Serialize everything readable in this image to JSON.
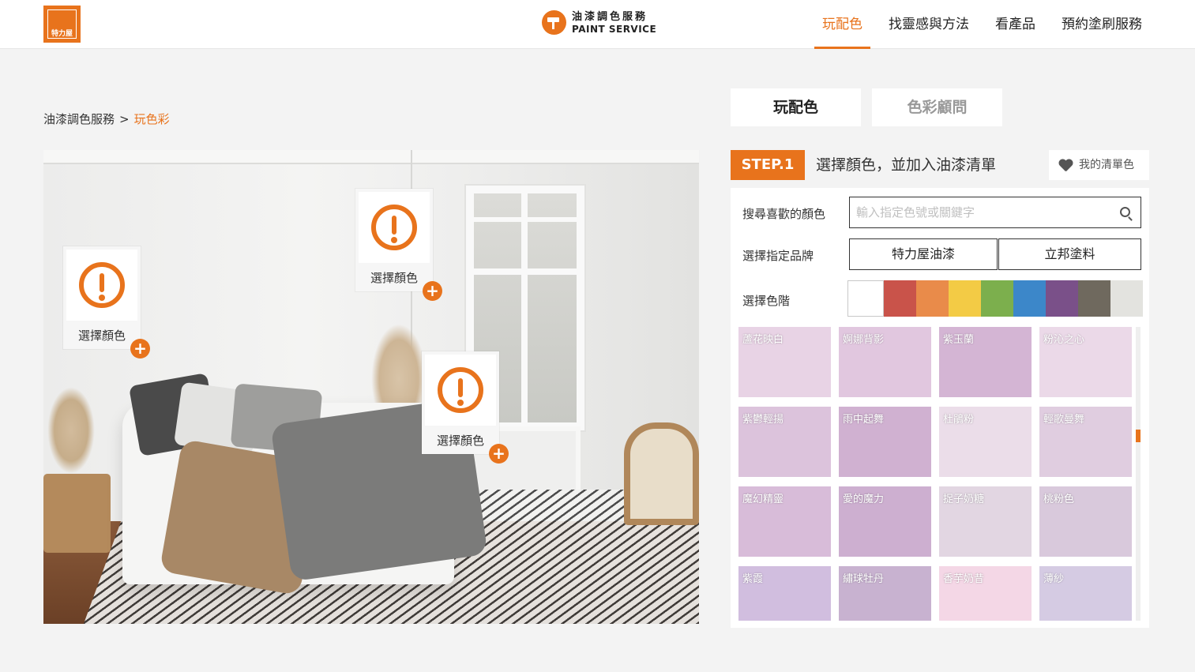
{
  "header": {
    "logo_text": "特力屋",
    "brand_zh": "油漆調色服務",
    "brand_en": "PAINT SERVICE",
    "nav": [
      "玩配色",
      "找靈感與方法",
      "看產品",
      "預約塗刷服務"
    ],
    "accent_color": "#e8731c"
  },
  "breadcrumb": {
    "root": "油漆調色服務",
    "separator": ">",
    "current": "玩色彩"
  },
  "room": {
    "hotspots": [
      {
        "label": "選擇顏色",
        "icon": "alert-icon"
      },
      {
        "label": "選擇顏色",
        "icon": "alert-icon"
      },
      {
        "label": "選擇顏色",
        "icon": "alert-icon"
      }
    ],
    "plus_symbol": "+"
  },
  "panel": {
    "tabs": [
      "玩配色",
      "色彩顧問"
    ],
    "step_badge": "STEP.1",
    "step_title": "選擇顏色，並加入油漆清單",
    "my_list_label": "我的清單色",
    "search_label": "搜尋喜歡的顏色",
    "search_placeholder": "輸入指定色號或關鍵字",
    "brand_label": "選擇指定品牌",
    "brands": [
      "特力屋油漆",
      "立邦塗料"
    ],
    "shade_label": "選擇色階",
    "shades": [
      "#ffffff",
      "#c9534a",
      "#e98b4a",
      "#f3cb45",
      "#7caf4d",
      "#3c87c9",
      "#7a5089",
      "#6f695e",
      "#e3e3df"
    ],
    "colors": [
      {
        "name": "蘆花映白",
        "hex": "#e8d3e5"
      },
      {
        "name": "婀娜背影",
        "hex": "#e1c7df"
      },
      {
        "name": "紫玉蘭",
        "hex": "#d4b5d4"
      },
      {
        "name": "粉沁之心",
        "hex": "#ebd9e8"
      },
      {
        "name": "紫鬱輕揚",
        "hex": "#dcc3dc"
      },
      {
        "name": "雨中起舞",
        "hex": "#d0b1d1"
      },
      {
        "name": "杜鵑粉",
        "hex": "#ebdde9"
      },
      {
        "name": "輕歌曼舞",
        "hex": "#e0cde0"
      },
      {
        "name": "魔幻精靈",
        "hex": "#d8bcd9"
      },
      {
        "name": "愛的魔力",
        "hex": "#cdafd0"
      },
      {
        "name": "捉子奶糖",
        "hex": "#e2d6e2"
      },
      {
        "name": "桃粉色",
        "hex": "#d9c9dc"
      },
      {
        "name": "紫霞",
        "hex": "#d1bedf"
      },
      {
        "name": "繡球牡丹",
        "hex": "#c8b2d0"
      },
      {
        "name": "香芋奶昔",
        "hex": "#f4d7e6"
      },
      {
        "name": "薄紗",
        "hex": "#d5cbe3"
      }
    ]
  }
}
